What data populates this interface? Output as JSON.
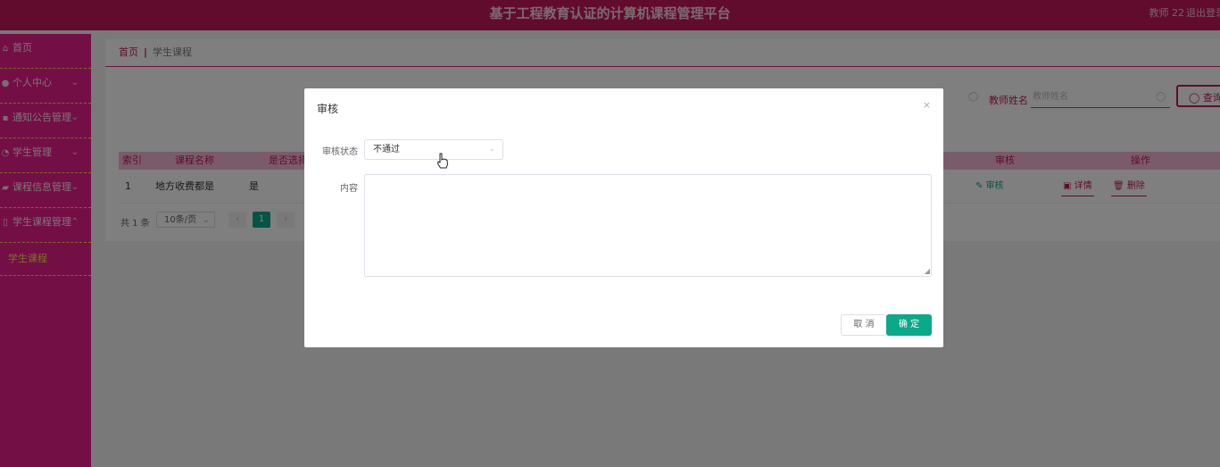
{
  "header": {
    "title": "基于工程教育认证的计算机课程管理平台",
    "user": "教师 22",
    "logout": "退出登录"
  },
  "sidebar": {
    "items": [
      {
        "label": "首页",
        "icon": "home-icon"
      },
      {
        "label": "个人中心",
        "icon": "user-icon"
      },
      {
        "label": "通知公告管理",
        "icon": "notice-icon"
      },
      {
        "label": "学生管理",
        "icon": "student-icon"
      },
      {
        "label": "课程信息管理",
        "icon": "course-icon"
      },
      {
        "label": "学生课程管理",
        "icon": "book-icon"
      }
    ],
    "active_sub": "学生课程"
  },
  "breadcrumb": {
    "home": "首页",
    "sep": "|",
    "current": "学生课程"
  },
  "search": {
    "teacher_label": "教师姓名",
    "teacher_placeholder": "教师姓名",
    "query_label": "查询"
  },
  "table": {
    "headers": [
      "索引",
      "课程名称",
      "是否选择",
      "审核",
      "操作"
    ],
    "row": {
      "index": "1",
      "course": "地方收费都是",
      "selected": "是",
      "audit_link": "审核",
      "detail_link": "详情",
      "delete_link": "删除"
    }
  },
  "pager": {
    "total": "共 1 条",
    "size": "10条/页",
    "prev": "‹",
    "current": "1",
    "next": "›"
  },
  "dialog": {
    "title": "审核",
    "close": "×",
    "status_label": "审核状态",
    "status_value": "不通过",
    "content_label": "内容",
    "cancel": "取 消",
    "confirm": "确 定"
  },
  "colors": {
    "header": "#c2185b",
    "sidebar": "#e91e8c",
    "accent": "#0aa98a",
    "submenu_active": "#f9e04b"
  }
}
